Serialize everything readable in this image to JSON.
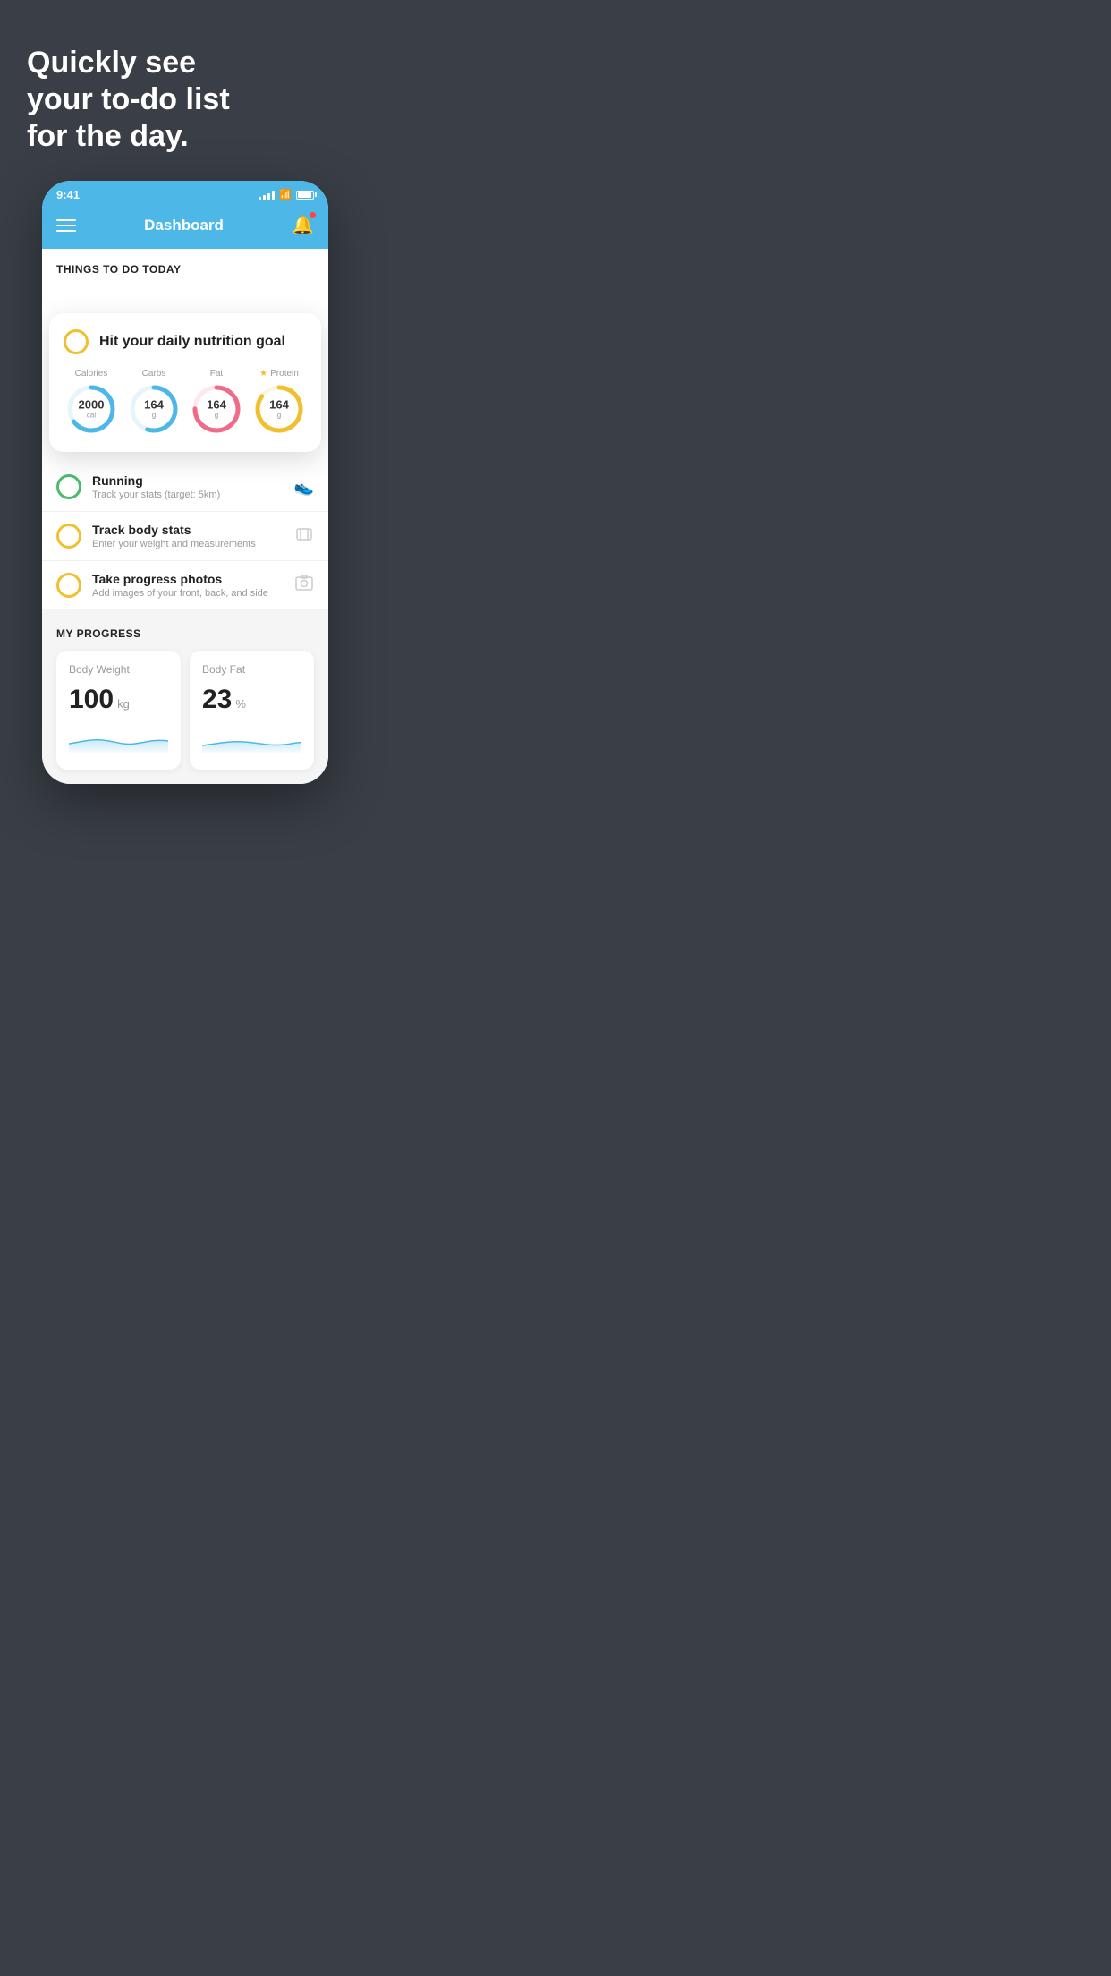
{
  "hero": {
    "title": "Quickly see\nyour to-do list\nfor the day."
  },
  "phone": {
    "status_bar": {
      "time": "9:41"
    },
    "nav": {
      "title": "Dashboard"
    },
    "things_section": {
      "title": "THINGS TO DO TODAY"
    },
    "nutrition_card": {
      "task_label": "Hit your daily nutrition goal",
      "items": [
        {
          "label": "Calories",
          "value": "2000",
          "unit": "cal",
          "color": "#4db8e8",
          "pct": 65
        },
        {
          "label": "Carbs",
          "value": "164",
          "unit": "g",
          "color": "#4db8e8",
          "pct": 55
        },
        {
          "label": "Fat",
          "value": "164",
          "unit": "g",
          "color": "#ee6b8a",
          "pct": 75
        },
        {
          "label": "Protein",
          "value": "164",
          "unit": "g",
          "color": "#f0c030",
          "pct": 85,
          "starred": true
        }
      ]
    },
    "task_list": [
      {
        "label": "Running",
        "sublabel": "Track your stats (target: 5km)",
        "icon": "👟",
        "circle_color": "#4cba6e",
        "checked": true
      },
      {
        "label": "Track body stats",
        "sublabel": "Enter your weight and measurements",
        "icon": "⊡",
        "circle_color": "#f0c030",
        "checked": false
      },
      {
        "label": "Take progress photos",
        "sublabel": "Add images of your front, back, and side",
        "icon": "👤",
        "circle_color": "#f0c030",
        "checked": false
      }
    ],
    "progress_section": {
      "title": "MY PROGRESS",
      "cards": [
        {
          "title": "Body Weight",
          "value": "100",
          "unit": "kg"
        },
        {
          "title": "Body Fat",
          "value": "23",
          "unit": "%"
        }
      ]
    }
  }
}
